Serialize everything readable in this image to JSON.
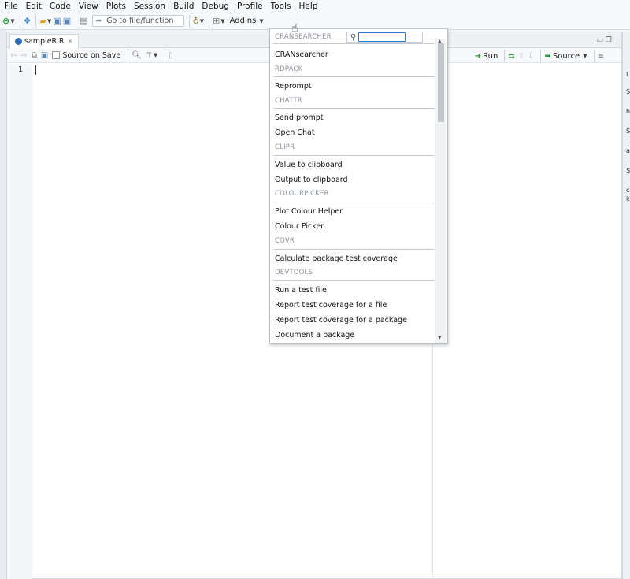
{
  "menubar": {
    "items": [
      "File",
      "Edit",
      "Code",
      "View",
      "Plots",
      "Session",
      "Build",
      "Debug",
      "Profile",
      "Tools",
      "Help"
    ]
  },
  "toolbar": {
    "goto_placeholder": "Go to file/function",
    "addins_label": "Addins"
  },
  "editor": {
    "file_tab": "sampleR.R",
    "source_on_save": "Source on Save",
    "run_label": "Run",
    "source_label": "Source",
    "line_number": "1"
  },
  "addins_menu": {
    "sections": [
      {
        "header": "CRANSEARCHER",
        "items": [
          "CRANsearcher"
        ]
      },
      {
        "header": "RDPACK",
        "items": [
          "Reprompt"
        ]
      },
      {
        "header": "CHATTR",
        "items": [
          "Send prompt",
          "Open Chat"
        ]
      },
      {
        "header": "CLIPR",
        "items": [
          "Value to clipboard",
          "Output to clipboard"
        ]
      },
      {
        "header": "COLOURPICKER",
        "items": [
          "Plot Colour Helper",
          "Colour Picker"
        ]
      },
      {
        "header": "COVR",
        "items": [
          "Calculate package test coverage"
        ]
      },
      {
        "header": "DEVTOOLS",
        "items": [
          "Run a test file",
          "Report test coverage for a file",
          "Report test coverage for a package",
          "Document a package"
        ]
      }
    ]
  },
  "right_panel": {
    "letters": [
      "I",
      "S",
      "h",
      "S",
      "a",
      "S",
      "c",
      "k"
    ]
  },
  "colors": {
    "accent": "#3478c6",
    "menu_header": "#8b9199",
    "file_icon": "#2e6fb5"
  },
  "icons": [
    "new-file-icon",
    "open-project-icon",
    "open-folder-icon",
    "save-icon",
    "save-all-icon",
    "print-icon",
    "goto-arrow-icon",
    "git-icon",
    "grid-icon",
    "search-icon",
    "wand-icon",
    "run-icon",
    "source-icon"
  ]
}
